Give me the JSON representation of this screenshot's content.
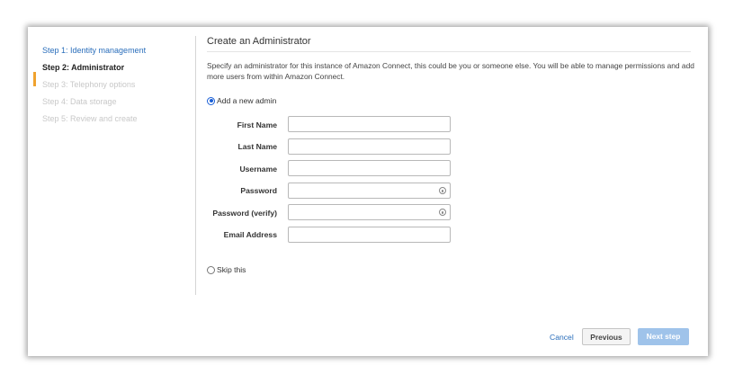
{
  "steps": [
    {
      "label": "Step 1: Identity management",
      "state": "done"
    },
    {
      "label": "Step 2: Administrator",
      "state": "active"
    },
    {
      "label": "Step 3: Telephony options",
      "state": "pending"
    },
    {
      "label": "Step 4: Data storage",
      "state": "pending"
    },
    {
      "label": "Step 5: Review and create",
      "state": "pending"
    }
  ],
  "main": {
    "title": "Create an Administrator",
    "description": "Specify an administrator for this instance of Amazon Connect, this could be you or someone else. You will be able to manage permissions and add more users from within Amazon Connect.",
    "option_add": "Add a new admin",
    "option_skip": "Skip this",
    "selected_option": "Add a new admin"
  },
  "fields": [
    {
      "label": "First Name",
      "value": "",
      "type": "text"
    },
    {
      "label": "Last Name",
      "value": "",
      "type": "text"
    },
    {
      "label": "Username",
      "value": "",
      "type": "text"
    },
    {
      "label": "Password",
      "value": "",
      "type": "password"
    },
    {
      "label": "Password (verify)",
      "value": "",
      "type": "password"
    },
    {
      "label": "Email Address",
      "value": "",
      "type": "text"
    }
  ],
  "footer": {
    "cancel_label": "Cancel",
    "previous_label": "Previous",
    "next_label": "Next step"
  },
  "colors": {
    "accent": "#f0a22e",
    "link": "#2a6ebb",
    "primary_disabled": "#9fc3ea"
  }
}
